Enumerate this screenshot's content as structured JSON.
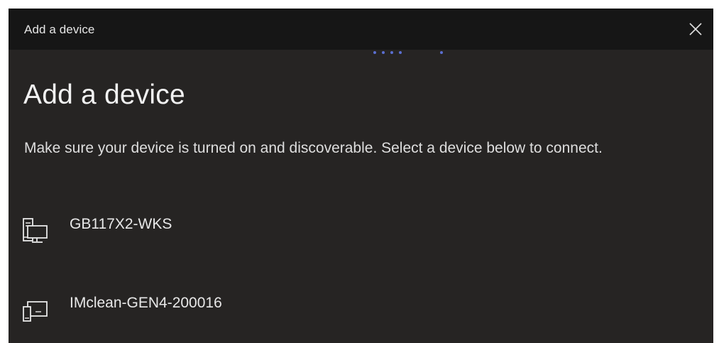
{
  "window": {
    "title": "Add a device",
    "close_icon": "close-icon"
  },
  "main": {
    "heading": "Add a device",
    "instructions": "Make sure your device is turned on and discoverable. Select a device below to connect."
  },
  "devices": [
    {
      "name": "GB117X2-WKS",
      "icon": "computer-icon"
    },
    {
      "name": "IMclean-GEN4-200016",
      "icon": "display-device-icon"
    }
  ],
  "colors": {
    "background": "#262423",
    "titlebar": "#161616",
    "text": "#f2f2f2",
    "accent": "#5b6fd1"
  }
}
